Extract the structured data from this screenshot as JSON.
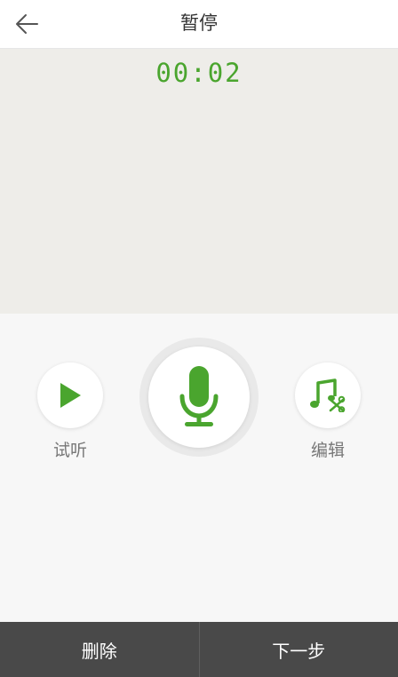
{
  "header": {
    "title": "暂停",
    "back_icon": "arrow-left-icon"
  },
  "recorder": {
    "timer": "00:02",
    "accent_color": "#4aa52e"
  },
  "controls": {
    "play": {
      "label": "试听",
      "icon": "play-icon"
    },
    "mic": {
      "icon": "microphone-icon"
    },
    "edit": {
      "label": "编辑",
      "icon": "music-scissors-icon"
    }
  },
  "footer": {
    "delete_label": "删除",
    "next_label": "下一步",
    "background": "#494949"
  }
}
